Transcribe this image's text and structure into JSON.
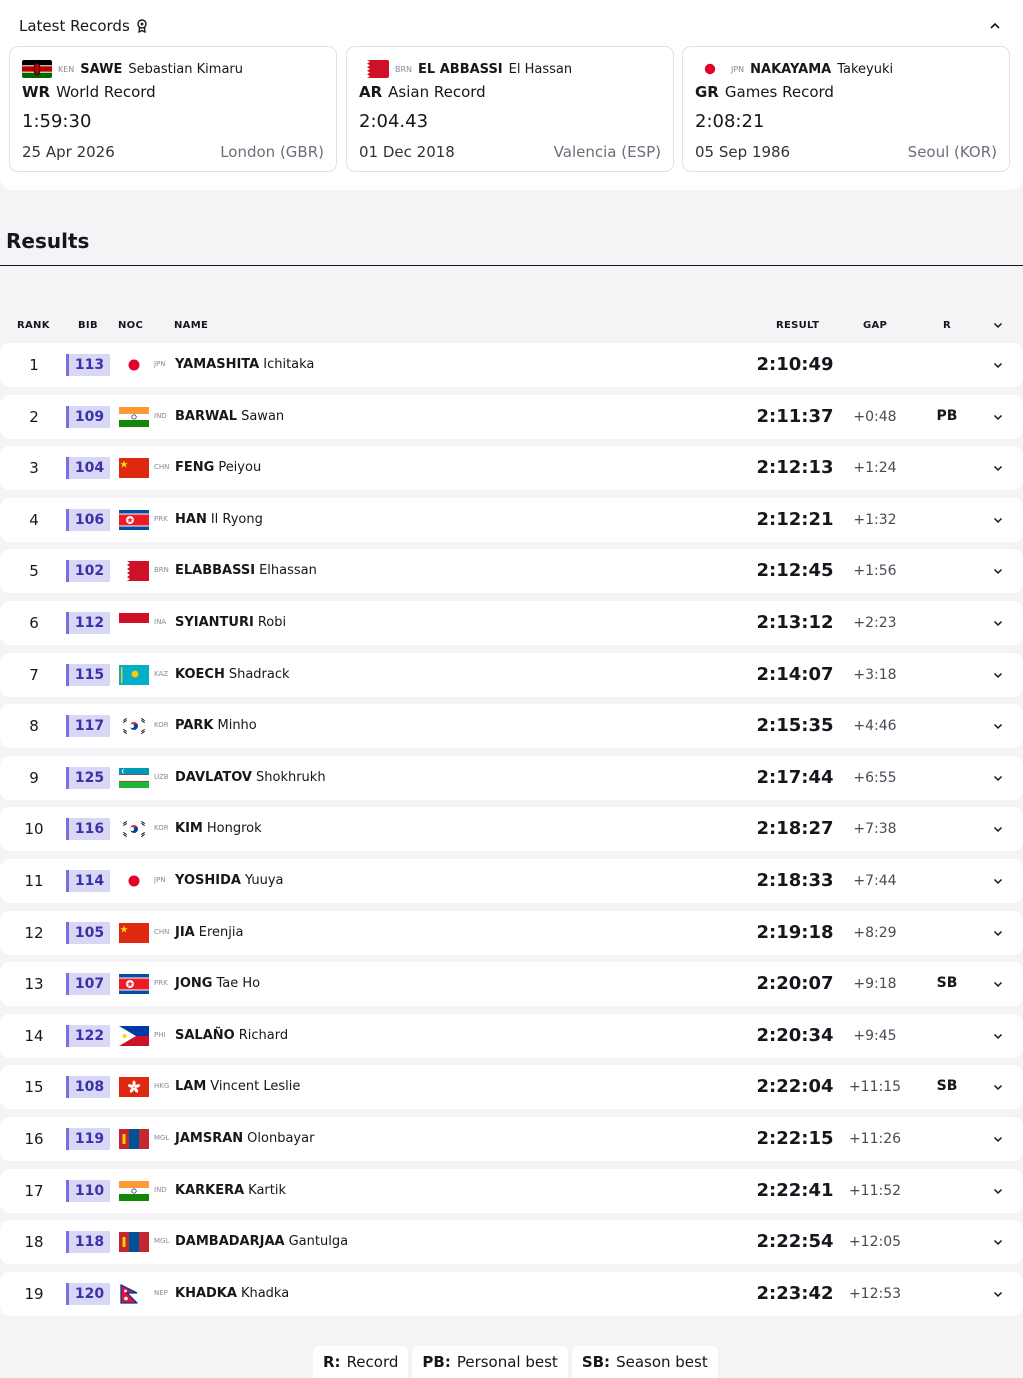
{
  "records": {
    "title": "Latest Records",
    "cards": [
      {
        "noc": "KEN",
        "last": "SAWE",
        "first": "Sebastian Kimaru",
        "code": "WR",
        "type": "World Record",
        "result": "1:59:30",
        "date": "25 Apr 2026",
        "venue": "London (GBR)",
        "flag": "ken"
      },
      {
        "noc": "BRN",
        "last": "EL ABBASSI",
        "first": "El Hassan",
        "code": "AR",
        "type": "Asian Record",
        "result": "2:04.43",
        "date": "01 Dec 2018",
        "venue": "Valencia (ESP)",
        "flag": "brn"
      },
      {
        "noc": "JPN",
        "last": "NAKAYAMA",
        "first": "Takeyuki",
        "code": "GR",
        "type": "Games Record",
        "result": "2:08:21",
        "date": "05 Sep 1986",
        "venue": "Seoul (KOR)",
        "flag": "jpn"
      }
    ]
  },
  "results": {
    "heading": "Results",
    "headers": {
      "rank": "RANK",
      "bib": "BIB",
      "noc": "NOC",
      "name": "NAME",
      "result": "RESULT",
      "gap": "GAP",
      "r": "R"
    },
    "rows": [
      {
        "rank": "1",
        "bib": "113",
        "noc": "JPN",
        "last": "YAMASHITA",
        "first": "Ichitaka",
        "result": "2:10:49",
        "gap": "",
        "r": "",
        "flag": "jpn"
      },
      {
        "rank": "2",
        "bib": "109",
        "noc": "IND",
        "last": "BARWAL",
        "first": "Sawan",
        "result": "2:11:37",
        "gap": "+0:48",
        "r": "PB",
        "flag": "ind"
      },
      {
        "rank": "3",
        "bib": "104",
        "noc": "CHN",
        "last": "FENG",
        "first": "Peiyou",
        "result": "2:12:13",
        "gap": "+1:24",
        "r": "",
        "flag": "chn"
      },
      {
        "rank": "4",
        "bib": "106",
        "noc": "PRK",
        "last": "HAN",
        "first": "Il Ryong",
        "result": "2:12:21",
        "gap": "+1:32",
        "r": "",
        "flag": "prk"
      },
      {
        "rank": "5",
        "bib": "102",
        "noc": "BRN",
        "last": "ELABBASSI",
        "first": "Elhassan",
        "result": "2:12:45",
        "gap": "+1:56",
        "r": "",
        "flag": "brn"
      },
      {
        "rank": "6",
        "bib": "112",
        "noc": "INA",
        "last": "SYIANTURI",
        "first": "Robi",
        "result": "2:13:12",
        "gap": "+2:23",
        "r": "",
        "flag": "ina"
      },
      {
        "rank": "7",
        "bib": "115",
        "noc": "KAZ",
        "last": "KOECH",
        "first": "Shadrack",
        "result": "2:14:07",
        "gap": "+3:18",
        "r": "",
        "flag": "kaz"
      },
      {
        "rank": "8",
        "bib": "117",
        "noc": "KOR",
        "last": "PARK",
        "first": "Minho",
        "result": "2:15:35",
        "gap": "+4:46",
        "r": "",
        "flag": "kor"
      },
      {
        "rank": "9",
        "bib": "125",
        "noc": "UZB",
        "last": "DAVLATOV",
        "first": "Shokhrukh",
        "result": "2:17:44",
        "gap": "+6:55",
        "r": "",
        "flag": "uzb"
      },
      {
        "rank": "10",
        "bib": "116",
        "noc": "KOR",
        "last": "KIM",
        "first": "Hongrok",
        "result": "2:18:27",
        "gap": "+7:38",
        "r": "",
        "flag": "kor"
      },
      {
        "rank": "11",
        "bib": "114",
        "noc": "JPN",
        "last": "YOSHIDA",
        "first": "Yuuya",
        "result": "2:18:33",
        "gap": "+7:44",
        "r": "",
        "flag": "jpn"
      },
      {
        "rank": "12",
        "bib": "105",
        "noc": "CHN",
        "last": "JIA",
        "first": "Erenjia",
        "result": "2:19:18",
        "gap": "+8:29",
        "r": "",
        "flag": "chn"
      },
      {
        "rank": "13",
        "bib": "107",
        "noc": "PRK",
        "last": "JONG",
        "first": "Tae Ho",
        "result": "2:20:07",
        "gap": "+9:18",
        "r": "SB",
        "flag": "prk"
      },
      {
        "rank": "14",
        "bib": "122",
        "noc": "PHI",
        "last": "SALAÑO",
        "first": "Richard",
        "result": "2:20:34",
        "gap": "+9:45",
        "r": "",
        "flag": "phi"
      },
      {
        "rank": "15",
        "bib": "108",
        "noc": "HKG",
        "last": "LAM",
        "first": "Vincent Leslie",
        "result": "2:22:04",
        "gap": "+11:15",
        "r": "SB",
        "flag": "hkg"
      },
      {
        "rank": "16",
        "bib": "119",
        "noc": "MGL",
        "last": "JAMSRAN",
        "first": "Olonbayar",
        "result": "2:22:15",
        "gap": "+11:26",
        "r": "",
        "flag": "mgl"
      },
      {
        "rank": "17",
        "bib": "110",
        "noc": "IND",
        "last": "KARKERA",
        "first": "Kartik",
        "result": "2:22:41",
        "gap": "+11:52",
        "r": "",
        "flag": "ind"
      },
      {
        "rank": "18",
        "bib": "118",
        "noc": "MGL",
        "last": "DAMBADARJAA",
        "first": "Gantulga",
        "result": "2:22:54",
        "gap": "+12:05",
        "r": "",
        "flag": "mgl"
      },
      {
        "rank": "19",
        "bib": "120",
        "noc": "NEP",
        "last": "KHADKA",
        "first": "Khadka",
        "result": "2:23:42",
        "gap": "+12:53",
        "r": "",
        "flag": "nep"
      }
    ]
  },
  "legend": {
    "items": [
      {
        "code": "R:",
        "label": "Record"
      },
      {
        "code": "PB:",
        "label": "Personal best"
      },
      {
        "code": "SB:",
        "label": "Season best"
      }
    ]
  }
}
